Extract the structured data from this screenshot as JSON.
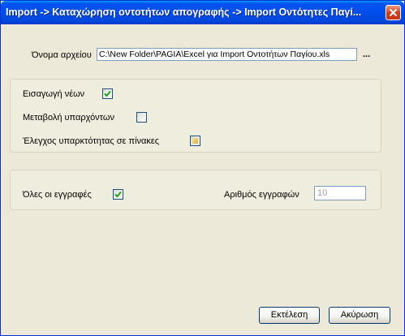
{
  "window": {
    "title": "Import -> Καταχώρηση οντοτήτων απογραφής -> Import Οντότητες Παγί..."
  },
  "file": {
    "label": "Όνομα αρχείου",
    "path": "C:\\New Folder\\PAGIA\\Excel για Import Οντοτήτων Παγίου.xls",
    "browse_label": "..."
  },
  "options": {
    "insert_new": {
      "label": "Εισαγωγή νέων",
      "state": "checked"
    },
    "modify_existing": {
      "label": "Μεταβολή υπαρχόντων",
      "state": "unchecked"
    },
    "check_tables": {
      "label": "Έλεγχος υπαρκτότητας σε πίνακες",
      "state": "indeterminate"
    }
  },
  "records": {
    "all_label": "Όλες οι εγγραφές",
    "all_state": "checked",
    "count_label": "Αριθμός εγγραφών",
    "count_value": "10"
  },
  "buttons": {
    "execute": "Εκτέλεση",
    "cancel": "Ακύρωση"
  },
  "colors": {
    "titlebar": "#0053ee",
    "window_bg": "#ece9d8",
    "check_green": "#21a121"
  }
}
